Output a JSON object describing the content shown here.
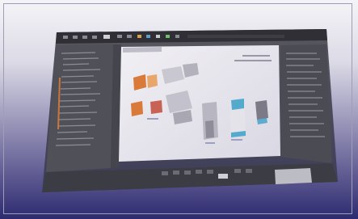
{
  "screen": {
    "description_kind": "angled photo of a CAD/PLM application window",
    "colors": {
      "background_top": "#f4f4f8",
      "background_bottom": "#2d2a70",
      "window_frame": "#3a3a40",
      "window_panel": "#55555c",
      "canvas": "#eceaf0",
      "accent_orange": "#d97a3a",
      "accent_teal": "#3aa0c8",
      "accent_red": "#c24a3a"
    },
    "window": {
      "title": "",
      "toolbar_icons": [
        "select-icon",
        "move-icon",
        "rotate-icon",
        "zoom-icon",
        "pan-icon",
        "fit-icon",
        "grid-icon",
        "measure-icon",
        "snap-icon",
        "layer-icon",
        "render-icon",
        "settings-icon"
      ],
      "left_tree_items": 18,
      "right_panel_rows": 14,
      "bottom_buttons": [
        "toolbar-btn-1",
        "toolbar-btn-2",
        "toolbar-btn-3",
        "toolbar-btn-4",
        "toolbar-btn-5",
        "toolbar-btn-6",
        "toolbar-btn-7",
        "toolbar-btn-8"
      ]
    }
  }
}
